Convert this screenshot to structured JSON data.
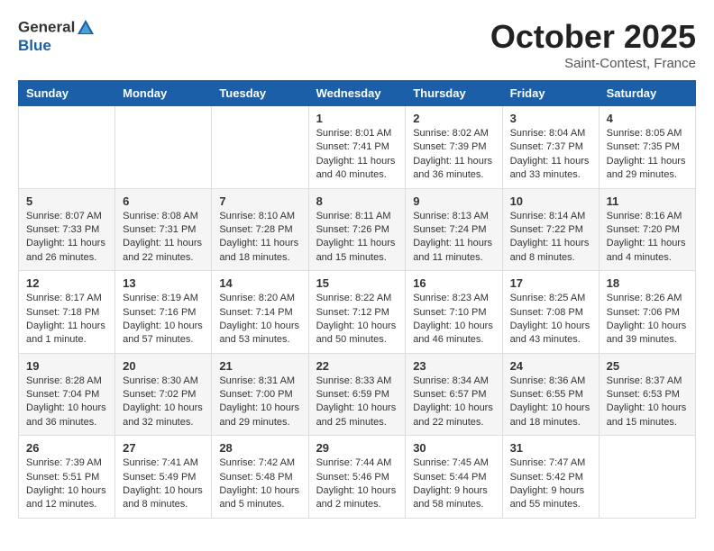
{
  "header": {
    "logo_general": "General",
    "logo_blue": "Blue",
    "month": "October 2025",
    "location": "Saint-Contest, France"
  },
  "weekdays": [
    "Sunday",
    "Monday",
    "Tuesday",
    "Wednesday",
    "Thursday",
    "Friday",
    "Saturday"
  ],
  "weeks": [
    [
      {
        "day": "",
        "info": ""
      },
      {
        "day": "",
        "info": ""
      },
      {
        "day": "",
        "info": ""
      },
      {
        "day": "1",
        "info": "Sunrise: 8:01 AM\nSunset: 7:41 PM\nDaylight: 11 hours and 40 minutes."
      },
      {
        "day": "2",
        "info": "Sunrise: 8:02 AM\nSunset: 7:39 PM\nDaylight: 11 hours and 36 minutes."
      },
      {
        "day": "3",
        "info": "Sunrise: 8:04 AM\nSunset: 7:37 PM\nDaylight: 11 hours and 33 minutes."
      },
      {
        "day": "4",
        "info": "Sunrise: 8:05 AM\nSunset: 7:35 PM\nDaylight: 11 hours and 29 minutes."
      }
    ],
    [
      {
        "day": "5",
        "info": "Sunrise: 8:07 AM\nSunset: 7:33 PM\nDaylight: 11 hours and 26 minutes."
      },
      {
        "day": "6",
        "info": "Sunrise: 8:08 AM\nSunset: 7:31 PM\nDaylight: 11 hours and 22 minutes."
      },
      {
        "day": "7",
        "info": "Sunrise: 8:10 AM\nSunset: 7:28 PM\nDaylight: 11 hours and 18 minutes."
      },
      {
        "day": "8",
        "info": "Sunrise: 8:11 AM\nSunset: 7:26 PM\nDaylight: 11 hours and 15 minutes."
      },
      {
        "day": "9",
        "info": "Sunrise: 8:13 AM\nSunset: 7:24 PM\nDaylight: 11 hours and 11 minutes."
      },
      {
        "day": "10",
        "info": "Sunrise: 8:14 AM\nSunset: 7:22 PM\nDaylight: 11 hours and 8 minutes."
      },
      {
        "day": "11",
        "info": "Sunrise: 8:16 AM\nSunset: 7:20 PM\nDaylight: 11 hours and 4 minutes."
      }
    ],
    [
      {
        "day": "12",
        "info": "Sunrise: 8:17 AM\nSunset: 7:18 PM\nDaylight: 11 hours and 1 minute."
      },
      {
        "day": "13",
        "info": "Sunrise: 8:19 AM\nSunset: 7:16 PM\nDaylight: 10 hours and 57 minutes."
      },
      {
        "day": "14",
        "info": "Sunrise: 8:20 AM\nSunset: 7:14 PM\nDaylight: 10 hours and 53 minutes."
      },
      {
        "day": "15",
        "info": "Sunrise: 8:22 AM\nSunset: 7:12 PM\nDaylight: 10 hours and 50 minutes."
      },
      {
        "day": "16",
        "info": "Sunrise: 8:23 AM\nSunset: 7:10 PM\nDaylight: 10 hours and 46 minutes."
      },
      {
        "day": "17",
        "info": "Sunrise: 8:25 AM\nSunset: 7:08 PM\nDaylight: 10 hours and 43 minutes."
      },
      {
        "day": "18",
        "info": "Sunrise: 8:26 AM\nSunset: 7:06 PM\nDaylight: 10 hours and 39 minutes."
      }
    ],
    [
      {
        "day": "19",
        "info": "Sunrise: 8:28 AM\nSunset: 7:04 PM\nDaylight: 10 hours and 36 minutes."
      },
      {
        "day": "20",
        "info": "Sunrise: 8:30 AM\nSunset: 7:02 PM\nDaylight: 10 hours and 32 minutes."
      },
      {
        "day": "21",
        "info": "Sunrise: 8:31 AM\nSunset: 7:00 PM\nDaylight: 10 hours and 29 minutes."
      },
      {
        "day": "22",
        "info": "Sunrise: 8:33 AM\nSunset: 6:59 PM\nDaylight: 10 hours and 25 minutes."
      },
      {
        "day": "23",
        "info": "Sunrise: 8:34 AM\nSunset: 6:57 PM\nDaylight: 10 hours and 22 minutes."
      },
      {
        "day": "24",
        "info": "Sunrise: 8:36 AM\nSunset: 6:55 PM\nDaylight: 10 hours and 18 minutes."
      },
      {
        "day": "25",
        "info": "Sunrise: 8:37 AM\nSunset: 6:53 PM\nDaylight: 10 hours and 15 minutes."
      }
    ],
    [
      {
        "day": "26",
        "info": "Sunrise: 7:39 AM\nSunset: 5:51 PM\nDaylight: 10 hours and 12 minutes."
      },
      {
        "day": "27",
        "info": "Sunrise: 7:41 AM\nSunset: 5:49 PM\nDaylight: 10 hours and 8 minutes."
      },
      {
        "day": "28",
        "info": "Sunrise: 7:42 AM\nSunset: 5:48 PM\nDaylight: 10 hours and 5 minutes."
      },
      {
        "day": "29",
        "info": "Sunrise: 7:44 AM\nSunset: 5:46 PM\nDaylight: 10 hours and 2 minutes."
      },
      {
        "day": "30",
        "info": "Sunrise: 7:45 AM\nSunset: 5:44 PM\nDaylight: 9 hours and 58 minutes."
      },
      {
        "day": "31",
        "info": "Sunrise: 7:47 AM\nSunset: 5:42 PM\nDaylight: 9 hours and 55 minutes."
      },
      {
        "day": "",
        "info": ""
      }
    ]
  ]
}
